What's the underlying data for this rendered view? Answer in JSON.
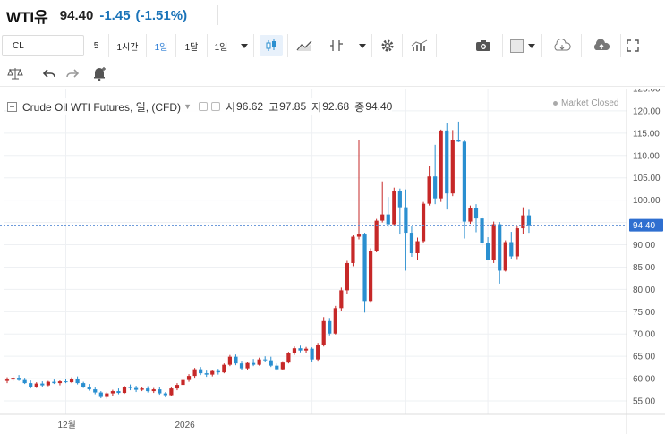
{
  "quote": {
    "symbol": "WTI유",
    "price": "94.40",
    "change": "-1.45",
    "change_pct": "(-1.51%)"
  },
  "toolbar": {
    "symbol": "CL",
    "intervals": [
      "5",
      "1시간",
      "1일",
      "1달",
      "1일"
    ],
    "active_interval": "1일"
  },
  "legend": {
    "title": "Crude Oil WTI Futures, 일, (CFD)",
    "open_label": "시",
    "open": "96.62",
    "high_label": "고",
    "high": "97.85",
    "low_label": "저",
    "low": "92.68",
    "close_label": "종",
    "close": "94.40"
  },
  "status": {
    "market": "Market Closed"
  },
  "colors": {
    "up": "#c62828",
    "down": "#2a8fd0",
    "price_tag": "#2f6fd0",
    "grid": "#eef0f3"
  },
  "chart_data": {
    "type": "candlestick",
    "title": "Crude Oil WTI Futures, 일, (CFD)",
    "ylim": [
      52,
      125
    ],
    "yticks": [
      55,
      60,
      65,
      70,
      75,
      80,
      85,
      90,
      95,
      100,
      105,
      110,
      115,
      120,
      125
    ],
    "ytick_labels": [
      "55.00",
      "60.00",
      "65.00",
      "70.00",
      "75.00",
      "80.00",
      "85.00",
      "90.00",
      "95.00",
      "100.00",
      "105.00",
      "110.00",
      "115.00",
      "120.00",
      "125.00"
    ],
    "xtick_labels": [
      {
        "label": "12월",
        "index": 10
      },
      {
        "label": "2026",
        "index": 30
      }
    ],
    "last_price": 94.4,
    "last_price_label": "94.40",
    "candles": [
      [
        59.5,
        60.3,
        59.0,
        59.8
      ],
      [
        59.8,
        60.6,
        59.4,
        60.2
      ],
      [
        60.2,
        60.8,
        59.5,
        59.7
      ],
      [
        59.7,
        60.2,
        58.8,
        59.0
      ],
      [
        59.0,
        59.6,
        57.8,
        58.2
      ],
      [
        58.2,
        59.2,
        57.9,
        58.9
      ],
      [
        58.9,
        59.4,
        58.2,
        58.5
      ],
      [
        58.5,
        59.5,
        58.3,
        59.3
      ],
      [
        59.3,
        59.8,
        58.8,
        59.0
      ],
      [
        59.0,
        59.6,
        58.5,
        59.4
      ],
      [
        59.4,
        60.0,
        59.0,
        59.2
      ],
      [
        59.2,
        60.3,
        59.0,
        60.0
      ],
      [
        60.0,
        60.5,
        58.7,
        59.0
      ],
      [
        59.0,
        59.3,
        57.9,
        58.2
      ],
      [
        58.2,
        58.8,
        57.3,
        57.6
      ],
      [
        57.6,
        58.0,
        56.5,
        56.9
      ],
      [
        56.9,
        57.2,
        55.6,
        55.9
      ],
      [
        55.9,
        57.0,
        55.5,
        56.7
      ],
      [
        56.7,
        57.5,
        56.2,
        57.2
      ],
      [
        57.2,
        57.8,
        56.5,
        56.8
      ],
      [
        56.8,
        58.4,
        56.6,
        58.1
      ],
      [
        58.1,
        58.7,
        57.4,
        57.9
      ],
      [
        57.9,
        58.4,
        57.0,
        57.5
      ],
      [
        57.5,
        58.1,
        57.2,
        57.8
      ],
      [
        57.8,
        58.3,
        56.9,
        57.2
      ],
      [
        57.2,
        57.9,
        56.8,
        57.6
      ],
      [
        57.6,
        58.1,
        56.4,
        56.7
      ],
      [
        56.7,
        57.0,
        55.8,
        56.3
      ],
      [
        56.3,
        58.0,
        56.1,
        57.8
      ],
      [
        57.8,
        59.0,
        57.4,
        58.6
      ],
      [
        58.6,
        60.0,
        58.2,
        59.7
      ],
      [
        59.7,
        61.0,
        59.3,
        60.6
      ],
      [
        60.6,
        62.4,
        60.2,
        62.1
      ],
      [
        62.1,
        62.6,
        60.8,
        61.2
      ],
      [
        61.2,
        61.8,
        60.4,
        60.9
      ],
      [
        60.9,
        62.0,
        60.5,
        61.7
      ],
      [
        61.7,
        62.2,
        60.9,
        61.4
      ],
      [
        61.4,
        63.4,
        61.2,
        63.1
      ],
      [
        63.1,
        65.3,
        62.8,
        64.9
      ],
      [
        64.9,
        65.4,
        63.0,
        63.4
      ],
      [
        63.4,
        64.0,
        61.9,
        62.3
      ],
      [
        62.3,
        63.8,
        62.0,
        63.5
      ],
      [
        63.5,
        64.4,
        62.8,
        63.1
      ],
      [
        63.1,
        64.7,
        62.9,
        64.3
      ],
      [
        64.3,
        65.0,
        63.8,
        64.1
      ],
      [
        64.1,
        64.9,
        62.6,
        62.9
      ],
      [
        62.9,
        63.4,
        61.8,
        62.1
      ],
      [
        62.1,
        63.9,
        61.9,
        63.6
      ],
      [
        63.6,
        66.0,
        63.4,
        65.7
      ],
      [
        65.7,
        67.2,
        65.3,
        66.8
      ],
      [
        66.8,
        67.4,
        65.9,
        66.3
      ],
      [
        66.3,
        67.1,
        65.8,
        66.7
      ],
      [
        66.7,
        67.0,
        63.8,
        64.3
      ],
      [
        64.3,
        68.0,
        64.0,
        67.6
      ],
      [
        67.6,
        73.8,
        67.2,
        72.9
      ],
      [
        72.9,
        73.6,
        69.7,
        70.1
      ],
      [
        70.1,
        76.3,
        69.9,
        75.8
      ],
      [
        75.8,
        80.4,
        75.2,
        79.8
      ],
      [
        79.8,
        86.4,
        78.9,
        85.9
      ],
      [
        85.9,
        92.1,
        85.2,
        91.8
      ],
      [
        91.8,
        113.5,
        91.2,
        92.3
      ],
      [
        92.3,
        92.7,
        74.8,
        77.4
      ],
      [
        77.4,
        89.2,
        77.0,
        88.7
      ],
      [
        88.7,
        95.8,
        88.3,
        95.4
      ],
      [
        95.4,
        104.2,
        95.0,
        96.8
      ],
      [
        96.8,
        100.7,
        94.0,
        94.6
      ],
      [
        94.6,
        102.8,
        94.3,
        102.1
      ],
      [
        102.1,
        102.6,
        92.3,
        98.4
      ],
      [
        98.4,
        102.4,
        84.2,
        92.7
      ],
      [
        92.7,
        94.1,
        87.3,
        88.1
      ],
      [
        88.1,
        91.6,
        86.5,
        90.8
      ],
      [
        90.8,
        99.6,
        90.3,
        99.2
      ],
      [
        99.2,
        107.6,
        98.8,
        105.3
      ],
      [
        105.3,
        112.4,
        99.1,
        100.4
      ],
      [
        100.4,
        115.8,
        99.6,
        115.6
      ],
      [
        115.6,
        117.2,
        97.9,
        101.5
      ],
      [
        101.5,
        115.7,
        100.9,
        113.4
      ],
      [
        113.4,
        117.6,
        113.0,
        113.1
      ],
      [
        113.1,
        113.5,
        91.4,
        95.2
      ],
      [
        95.2,
        98.8,
        94.7,
        98.3
      ],
      [
        98.3,
        99.1,
        92.8,
        95.9
      ],
      [
        95.9,
        96.5,
        89.3,
        90.3
      ],
      [
        90.3,
        91.7,
        86.6,
        86.5
      ],
      [
        86.5,
        95.2,
        85.9,
        94.6
      ],
      [
        94.6,
        95.1,
        81.3,
        84.2
      ],
      [
        84.2,
        91.0,
        84.0,
        90.6
      ],
      [
        90.6,
        92.9,
        86.9,
        87.4
      ],
      [
        87.4,
        94.3,
        86.8,
        93.7
      ],
      [
        93.7,
        98.4,
        92.4,
        96.6
      ],
      [
        96.6,
        97.85,
        92.68,
        94.4
      ]
    ]
  }
}
